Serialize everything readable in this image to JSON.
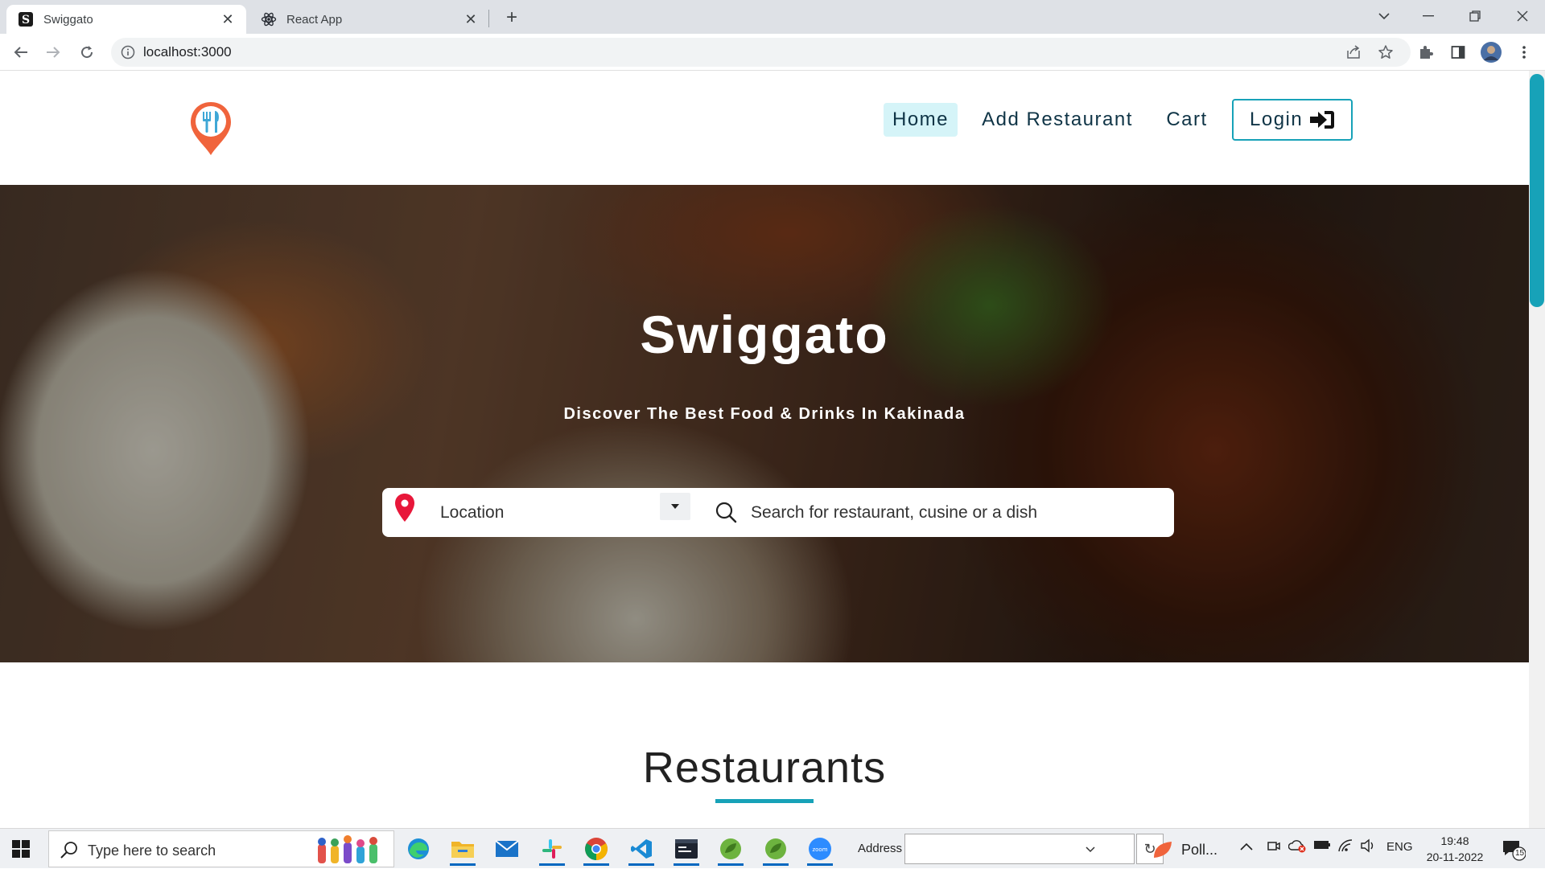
{
  "browser": {
    "tabs": [
      {
        "title": "Swiggato",
        "active": true
      },
      {
        "title": "React App",
        "active": false
      }
    ],
    "url": "localhost:3000"
  },
  "header": {
    "nav": {
      "home": "Home",
      "add_restaurant": "Add Restaurant",
      "cart": "Cart",
      "login": "Login"
    }
  },
  "hero": {
    "title": "Swiggato",
    "subtitle": "Discover The Best Food & Drinks In Kakinada",
    "location_select": "Location",
    "search_placeholder": "Search for restaurant, cusine or a dish"
  },
  "section": {
    "title": "Restaurants"
  },
  "taskbar": {
    "search_placeholder": "Type here to search",
    "address_label": "Address",
    "poll_label": "Poll...",
    "language": "ENG",
    "time": "19:48",
    "date": "20-11-2022",
    "notification_count": "15"
  },
  "colors": {
    "accent": "#17a2b8",
    "nav_text": "#0f3446",
    "home_bg": "#d5f4f8",
    "pin_red": "#e8173a",
    "logo_orange": "#f0643c"
  }
}
